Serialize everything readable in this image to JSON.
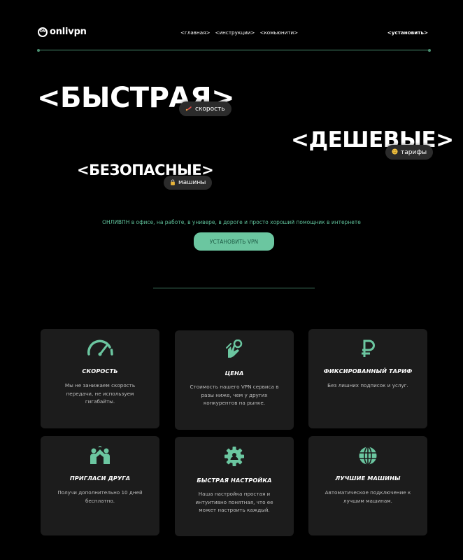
{
  "header": {
    "logo_text": "onlivpn",
    "logo_mark": "ON",
    "nav": [
      "<главная>",
      "<инструкции>",
      "<комьюнити>"
    ],
    "install_link": "<установить>"
  },
  "hero": {
    "headline_1": "<БЫСТРАЯ>",
    "headline_2": "<ДЕШЕВЫЕ>",
    "headline_3": "<БЕЗОПАСНЫЕ>",
    "pill_1": "скорость",
    "pill_1_icon": "rocket-emoji",
    "pill_2": "тарифы",
    "pill_2_icon": "smiley-emoji",
    "pill_3": "машины",
    "pill_3_icon": "lock-emoji",
    "tagline": "ОНЛИВПН в офисе, на работе, в универе, в дороге и просто хороший помощник в интернете",
    "cta_label": "УСТАНОВИТЬ VPN"
  },
  "features": [
    {
      "title": "СКОРОСТЬ",
      "desc": "Мы не занижаем скорость передачи, не используем гигабайты.",
      "icon": "speedometer-icon"
    },
    {
      "title": "ЦЕНА",
      "desc": "Стоимость нашего VPN сервиса в разы ниже, чем у других конкурентов на рынке.",
      "icon": "hand-coin-icon"
    },
    {
      "title": "ФИКСИРОВАННЫЙ ТАРИФ",
      "desc": "Без лишних подписок и услуг.",
      "icon": "ruble-icon"
    },
    {
      "title": "ПРИГЛАСИ ДРУГА",
      "desc": "Получи дополнительно 10 дней бесплатно.",
      "icon": "friends-icon"
    },
    {
      "title": "БЫСТРАЯ НАСТРОЙКА",
      "desc": "Наша настройка простая и интуитивно понятная, что ее может настроить каждый.",
      "icon": "gear-icon"
    },
    {
      "title": "ЛУЧШИЕ МАШИНЫ",
      "desc": "Автоматическое подключение к лучшим машинам.",
      "icon": "globe-icon"
    }
  ],
  "colors": {
    "background": "#000000",
    "accent": "#6bc6a0",
    "card": "#1c1c1c",
    "line": "#4a8f70"
  }
}
